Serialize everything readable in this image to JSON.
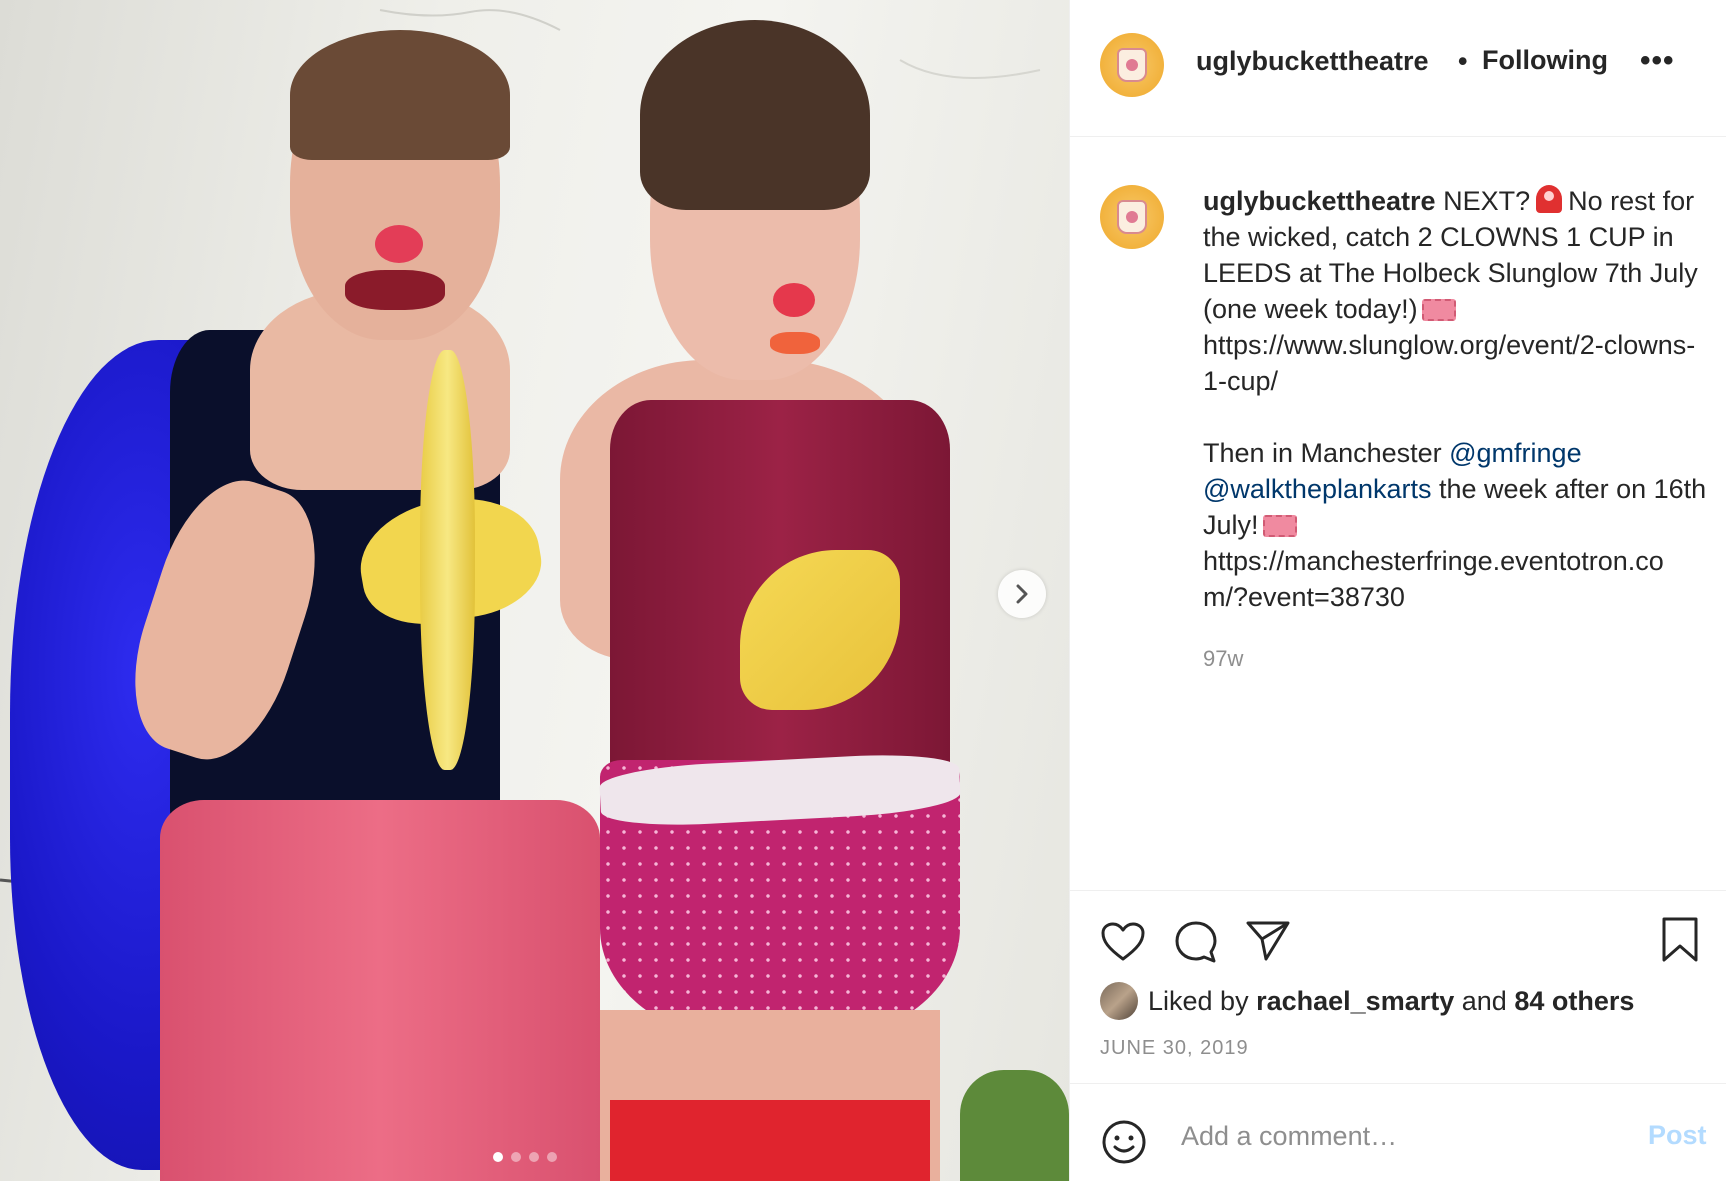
{
  "header": {
    "username": "uglybuckettheatre",
    "separator": "•",
    "follow_status": "Following",
    "more_label": "•••"
  },
  "caption": {
    "username": "uglybuckettheatre",
    "part1": "NEXT?",
    "part2": "No rest for the wicked, catch 2 CLOWNS 1 CUP in LEEDS at The Holbeck Slunglow 7th July (one week today!)",
    "link1": "https://www.slunglow.org/event/2-clowns-1-cup/",
    "part3": "Then in Manchester ",
    "mention1": "@gmfringe",
    "mention2": "@walktheplankarts",
    "part4": " the week after on 16th July!",
    "link2": "https://manchesterfringe.eventotron.com/?event=38730",
    "emoji_siren": "siren-icon",
    "emoji_ticket": "ticket-icon",
    "age": "97w"
  },
  "likes": {
    "prefix": "Liked by ",
    "user": "rachael_smarty",
    "middle": " and ",
    "others": "84 others"
  },
  "date": "JUNE 30, 2019",
  "comment": {
    "placeholder": "Add a comment…",
    "post_label": "Post"
  },
  "carousel": {
    "slide_count": 4,
    "active_index": 0
  },
  "colors": {
    "text": "#262626",
    "secondary": "#8e8e8e",
    "mention": "#00376b",
    "post_disabled": "#b3dbff",
    "avatar": "#f2b23d"
  }
}
